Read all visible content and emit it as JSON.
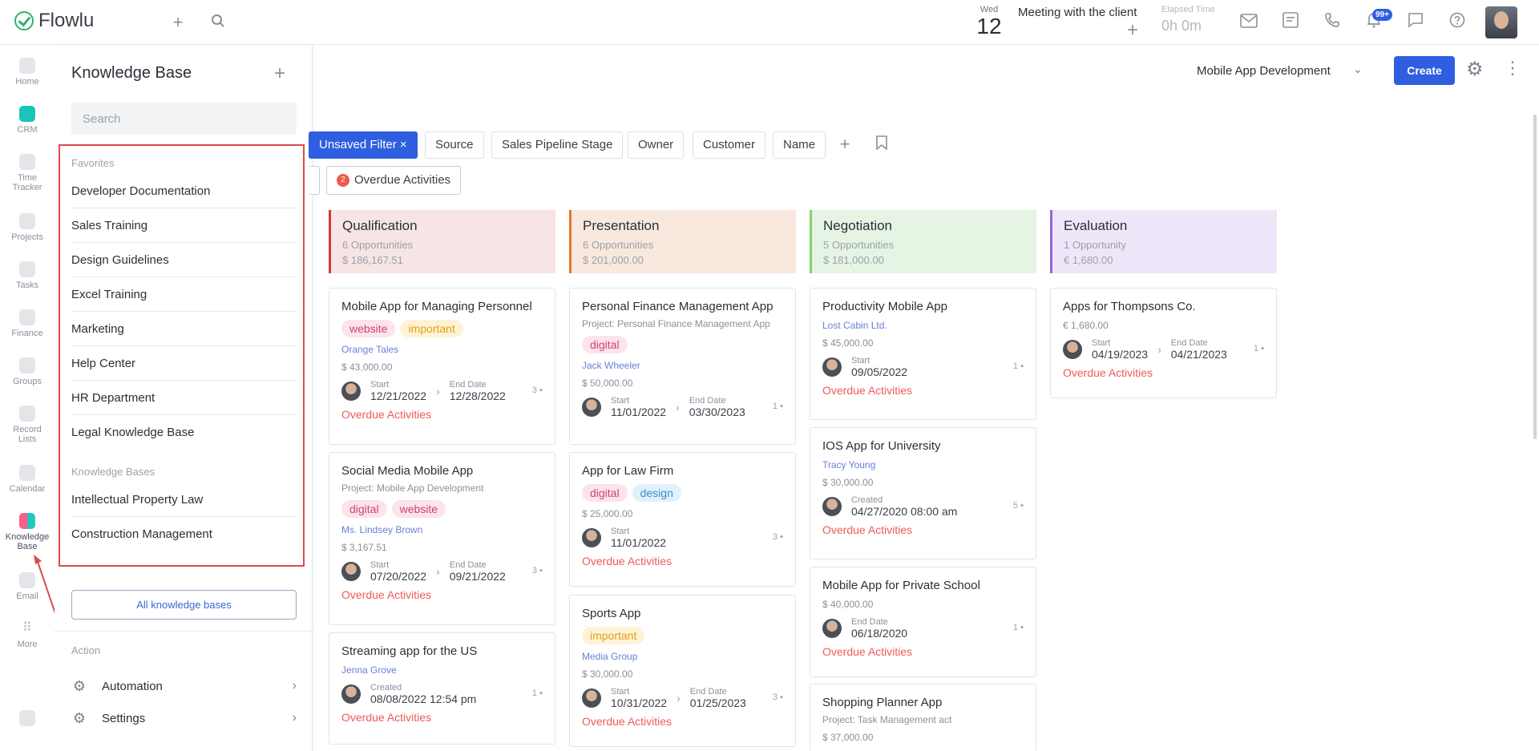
{
  "topbar": {
    "logo": "Flowlu",
    "date_dow": "Wed",
    "date_day": "12",
    "meeting": "Meeting with the client",
    "elapsed_label": "Elapsed Time",
    "elapsed_value": "0h 0m",
    "notif_badge": "99+"
  },
  "rail": [
    {
      "label": "Home"
    },
    {
      "label": "CRM"
    },
    {
      "label": "Time Tracker"
    },
    {
      "label": "Projects"
    },
    {
      "label": "Tasks"
    },
    {
      "label": "Finance"
    },
    {
      "label": "Groups"
    },
    {
      "label": "Record Lists"
    },
    {
      "label": "Calendar"
    },
    {
      "label": "Knowledge Base"
    },
    {
      "label": "Email"
    },
    {
      "label": "More"
    }
  ],
  "kb": {
    "title": "Knowledge Base",
    "search_placeholder": "Search",
    "favorites_label": "Favorites",
    "favorites": [
      "Developer Documentation",
      "Sales Training",
      "Design Guidelines",
      "Excel Training",
      "Marketing",
      "Help Center",
      "HR Department",
      "Legal Knowledge Base"
    ],
    "bases_label": "Knowledge Bases",
    "bases": [
      "Intellectual Property Law",
      "Construction Management"
    ],
    "all_button": "All knowledge bases",
    "action_label": "Action",
    "actions": [
      "Automation",
      "Settings"
    ]
  },
  "main": {
    "project": "Mobile App Development",
    "create": "Create",
    "filters": [
      "Unsaved Filter ×",
      "Source",
      "Sales Pipeline Stage",
      "Owner",
      "Customer",
      "Name"
    ],
    "overdue_count": "2",
    "overdue_label": "Overdue Activities"
  },
  "columns": [
    {
      "title": "Qualification",
      "count": "6 Opportunities",
      "amount": "$ 186,167.51"
    },
    {
      "title": "Presentation",
      "count": "6 Opportunities",
      "amount": "$ 201,000.00"
    },
    {
      "title": "Negotiation",
      "count": "5 Opportunities",
      "amount": "$ 181,000.00"
    },
    {
      "title": "Evaluation",
      "count": "1 Opportunity",
      "amount": "€ 1,680.00"
    }
  ],
  "cards": {
    "q1": {
      "title": "Mobile App for Managing Personnel",
      "tags": [
        "website",
        "important"
      ],
      "client": "Orange Tales",
      "amount": "$ 43,000.00",
      "start_label": "Start",
      "start": "12/21/2022",
      "end_label": "End Date",
      "end": "12/28/2022",
      "comments": "3",
      "overdue": "Overdue Activities"
    },
    "q2": {
      "title": "Social Media Mobile App",
      "project": "Project: Mobile App Development",
      "tags": [
        "digital",
        "website"
      ],
      "client": "Ms. Lindsey Brown",
      "amount": "$ 3,167.51",
      "start_label": "Start",
      "start": "07/20/2022",
      "end_label": "End Date",
      "end": "09/21/2022",
      "comments": "3",
      "overdue": "Overdue Activities"
    },
    "q3": {
      "title": "Streaming app for the US",
      "client": "Jenna Grove",
      "created_label": "Created",
      "created": "08/08/2022 12:54 pm",
      "comments": "1",
      "overdue": "Overdue Activities"
    },
    "p1": {
      "title": "Personal Finance Management App",
      "project": "Project: Personal Finance Management App",
      "tags": [
        "digital"
      ],
      "client": "Jack Wheeler",
      "amount": "$ 50,000.00",
      "start_label": "Start",
      "start": "11/01/2022",
      "end_label": "End Date",
      "end": "03/30/2023",
      "comments": "1",
      "overdue": "Overdue Activities"
    },
    "p2": {
      "title": "App for Law Firm",
      "tags": [
        "digital",
        "design"
      ],
      "amount": "$ 25,000.00",
      "start_label": "Start",
      "start": "11/01/2022",
      "comments": "3",
      "overdue": "Overdue Activities"
    },
    "p3": {
      "title": "Sports App",
      "tags": [
        "important"
      ],
      "client": "Media Group",
      "amount": "$ 30,000.00",
      "start_label": "Start",
      "start": "10/31/2022",
      "end_label": "End Date",
      "end": "01/25/2023",
      "comments": "3",
      "overdue": "Overdue Activities"
    },
    "n1": {
      "title": "Productivity Mobile App",
      "client": "Lost Cabin Ltd.",
      "amount": "$ 45,000.00",
      "start_label": "Start",
      "start": "09/05/2022",
      "comments": "1",
      "overdue": "Overdue Activities"
    },
    "n2": {
      "title": "IOS App for University",
      "client": "Tracy Young",
      "amount": "$ 30,000.00",
      "created_label": "Created",
      "created": "04/27/2020 08:00 am",
      "comments": "5",
      "overdue": "Overdue Activities"
    },
    "n3": {
      "title": "Mobile App for Private School",
      "amount": "$ 40,000.00",
      "end_label": "End Date",
      "end": "06/18/2020",
      "comments": "1",
      "overdue": "Overdue Activities"
    },
    "n4": {
      "title": "Shopping Planner App",
      "project": "Project: Task Management act",
      "amount": "$ 37,000.00"
    },
    "e1": {
      "title": "Apps for Thompsons Co.",
      "amount": "€ 1,680.00",
      "start_label": "Start",
      "start": "04/19/2023",
      "end_label": "End Date",
      "end": "04/21/2023",
      "comments": "1",
      "overdue": "Overdue Activities"
    }
  }
}
